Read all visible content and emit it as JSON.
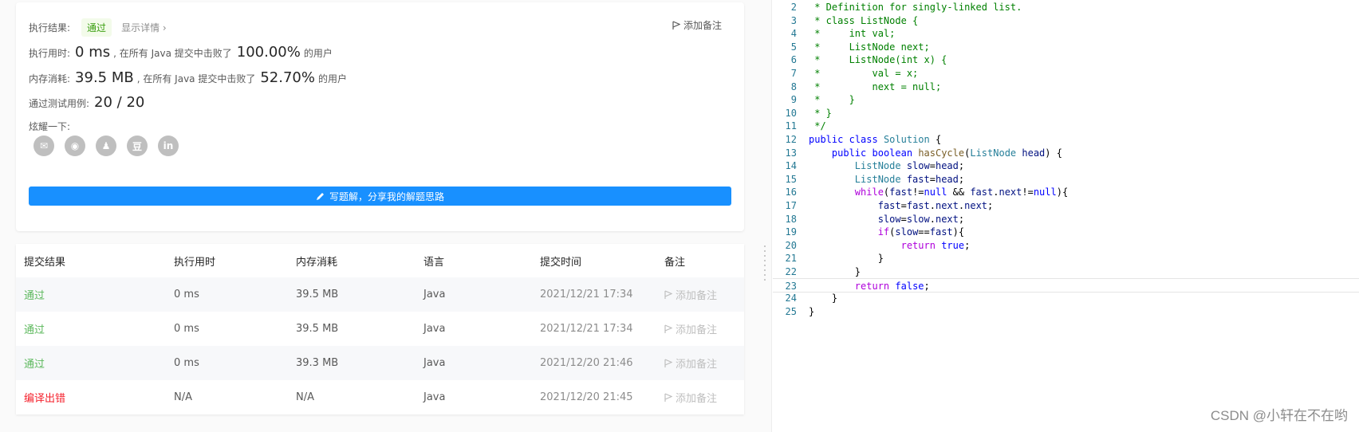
{
  "summary": {
    "result_label": "执行结果:",
    "result_badge": "通过",
    "details_link": "显示详情 ›",
    "add_note": "添加备注",
    "runtime_label": "执行用时:",
    "runtime_value": "0 ms",
    "runtime_text": ", 在所有 Java 提交中击败了",
    "runtime_percent": "100.00%",
    "runtime_suffix": "的用户",
    "memory_label": "内存消耗:",
    "memory_value": "39.5 MB",
    "memory_text": ", 在所有 Java 提交中击败了",
    "memory_percent": "52.70%",
    "memory_suffix": "的用户",
    "tests_label": "通过测试用例:",
    "tests_value": "20 / 20",
    "share_label": "炫耀一下:",
    "share_icons": [
      "wechat-icon",
      "weibo-icon",
      "qq-icon",
      "douban-icon",
      "linkedin-icon"
    ],
    "share_glyphs": [
      "✉",
      "◉",
      "♟",
      "豆",
      "in"
    ],
    "write_button": "写题解，分享我的解题思路"
  },
  "table": {
    "headers": [
      "提交结果",
      "执行用时",
      "内存消耗",
      "语言",
      "提交时间",
      "备注"
    ],
    "rows": [
      {
        "status": "通过",
        "status_type": "ok",
        "runtime": "0 ms",
        "memory": "39.5 MB",
        "lang": "Java",
        "time": "2021/12/21 17:34",
        "note": "添加备注"
      },
      {
        "status": "通过",
        "status_type": "ok",
        "runtime": "0 ms",
        "memory": "39.5 MB",
        "lang": "Java",
        "time": "2021/12/21 17:34",
        "note": "添加备注"
      },
      {
        "status": "通过",
        "status_type": "ok",
        "runtime": "0 ms",
        "memory": "39.3 MB",
        "lang": "Java",
        "time": "2021/12/20 21:46",
        "note": "添加备注"
      },
      {
        "status": "编译出错",
        "status_type": "err",
        "runtime": "N/A",
        "memory": "N/A",
        "lang": "Java",
        "time": "2021/12/20 21:45",
        "note": "添加备注"
      }
    ]
  },
  "editor": {
    "lines": [
      {
        "n": "2",
        "t": " * Definition for singly-linked list."
      },
      {
        "n": "3",
        "t": " * class ListNode {"
      },
      {
        "n": "4",
        "t": " *     int val;"
      },
      {
        "n": "5",
        "t": " *     ListNode next;"
      },
      {
        "n": "6",
        "t": " *     ListNode(int x) {"
      },
      {
        "n": "7",
        "t": " *         val = x;"
      },
      {
        "n": "8",
        "t": " *         next = null;"
      },
      {
        "n": "9",
        "t": " *     }"
      },
      {
        "n": "10",
        "t": " * }"
      },
      {
        "n": "11",
        "t": " */"
      },
      {
        "n": "12",
        "t": "public class Solution {"
      },
      {
        "n": "13",
        "t": "    public boolean hasCycle(ListNode head) {"
      },
      {
        "n": "14",
        "t": "        ListNode slow=head;"
      },
      {
        "n": "15",
        "t": "        ListNode fast=head;"
      },
      {
        "n": "16",
        "t": "        while(fast!=null && fast.next!=null){"
      },
      {
        "n": "17",
        "t": "            fast=fast.next.next;"
      },
      {
        "n": "18",
        "t": "            slow=slow.next;"
      },
      {
        "n": "19",
        "t": "            if(slow==fast){"
      },
      {
        "n": "20",
        "t": "                return true;"
      },
      {
        "n": "21",
        "t": "            }"
      },
      {
        "n": "22",
        "t": "        }"
      },
      {
        "n": "23",
        "t": "        return false;"
      },
      {
        "n": "24",
        "t": "    }"
      },
      {
        "n": "25",
        "t": "}"
      }
    ]
  },
  "watermark": "CSDN @小轩在不在哟"
}
